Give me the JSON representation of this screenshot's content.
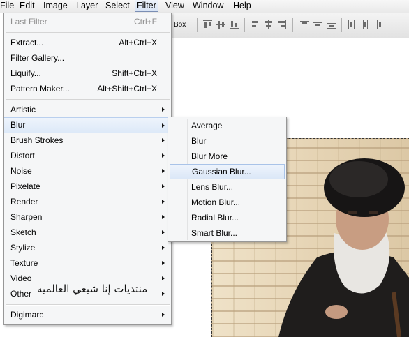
{
  "menubar": {
    "items": [
      "File",
      "Edit",
      "Image",
      "Layer",
      "Select",
      "Filter",
      "View",
      "Window",
      "Help"
    ],
    "active": "Filter"
  },
  "toolbar": {
    "partial_label": "Box",
    "icons": [
      "align-top-icon",
      "align-vertical-center-icon",
      "align-bottom-icon",
      "align-left-icon",
      "align-horizontal-center-icon",
      "align-right-icon",
      "distribute-top-icon",
      "distribute-vertical-center-icon",
      "distribute-bottom-icon",
      "distribute-left-icon",
      "distribute-horizontal-center-icon",
      "distribute-right-icon"
    ]
  },
  "filter_menu": {
    "last_filter": {
      "label": "Last Filter",
      "shortcut": "Ctrl+F"
    },
    "group1": [
      {
        "label": "Extract...",
        "shortcut": "Alt+Ctrl+X"
      },
      {
        "label": "Filter Gallery...",
        "shortcut": ""
      },
      {
        "label": "Liquify...",
        "shortcut": "Shift+Ctrl+X"
      },
      {
        "label": "Pattern Maker...",
        "shortcut": "Alt+Shift+Ctrl+X"
      }
    ],
    "group2": [
      "Artistic",
      "Blur",
      "Brush Strokes",
      "Distort",
      "Noise",
      "Pixelate",
      "Render",
      "Sharpen",
      "Sketch",
      "Stylize",
      "Texture",
      "Video",
      "Other"
    ],
    "group3": [
      "Digimarc"
    ],
    "highlighted": "Blur"
  },
  "blur_submenu": {
    "items": [
      "Average",
      "Blur",
      "Blur More",
      "Gaussian Blur...",
      "Lens Blur...",
      "Motion Blur...",
      "Radial Blur...",
      "Smart Blur..."
    ],
    "highlighted": "Gaussian Blur..."
  },
  "watermark": "منتديات إنا شيعي العالميه",
  "colors": {
    "menu_bg": "#f5f6f7",
    "highlight": "#dde9f8",
    "highlight_border": "#b9cfee",
    "disabled_text": "#8f8f8f"
  }
}
